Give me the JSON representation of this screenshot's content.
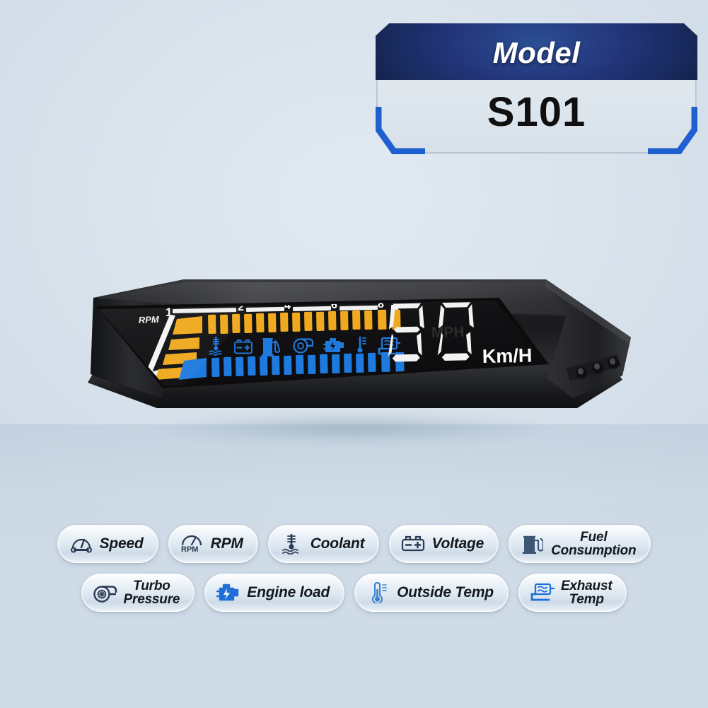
{
  "background": {
    "top_color": "#dce5ee",
    "bottom_color": "#c6d4e0"
  },
  "model_badge": {
    "header_label": "Model",
    "model_number": "S101",
    "header_color": "#1d2f6b",
    "accent_color": "#1f5fd0"
  },
  "device": {
    "type": "head-up-display",
    "body_color": "#1c1c1e",
    "screen": {
      "background_color": "#141416",
      "speed_value": "80",
      "speed_unit": "Km/H",
      "inactive_unit": "MPH",
      "rpm_label": "RPM",
      "rpm_scale_low": "0",
      "rpm_scale_high": "1",
      "rpm_ticks": [
        "1",
        "2",
        "4",
        "6",
        "8"
      ],
      "bar_top_color": "#f0a91e",
      "bar_bottom_color": "#1f7ae0",
      "top_bar_segments": 22,
      "bottom_bar_segments": 22,
      "status_icons": [
        "coolant-temp-icon",
        "battery-voltage-icon",
        "fuel-pump-icon",
        "turbo-icon",
        "engine-load-icon",
        "outside-temp-icon",
        "exhaust-temp-icon"
      ]
    },
    "buttons": [
      "button-left",
      "button-middle",
      "button-right"
    ]
  },
  "features": {
    "row1": [
      {
        "label": "Speed",
        "icon": "speedometer-icon",
        "two_line": false,
        "icon_color": "#2b3a54"
      },
      {
        "label": "RPM",
        "icon": "rpm-gauge-icon",
        "two_line": false,
        "icon_color": "#2b3a54"
      },
      {
        "label": "Coolant",
        "icon": "coolant-temp-icon",
        "two_line": false,
        "icon_color": "#2b3a54"
      },
      {
        "label": "Voltage",
        "icon": "battery-voltage-icon",
        "two_line": false,
        "icon_color": "#2b3a54"
      },
      {
        "label": "Fuel\nConsumption",
        "icon": "fuel-pump-icon",
        "two_line": true,
        "icon_color": "#3c5674"
      }
    ],
    "row2": [
      {
        "label": "Turbo\nPressure",
        "icon": "turbo-icon",
        "two_line": true,
        "icon_color": "#2b3a54"
      },
      {
        "label": "Engine load",
        "icon": "engine-load-icon",
        "two_line": false,
        "icon_color": "#1f6fd8"
      },
      {
        "label": "Outside Temp",
        "icon": "outside-temp-icon",
        "two_line": false,
        "icon_color": "#3a7fd0"
      },
      {
        "label": "Exhaust\nTemp",
        "icon": "exhaust-temp-icon",
        "two_line": true,
        "icon_color": "#1f6fd8"
      }
    ]
  }
}
